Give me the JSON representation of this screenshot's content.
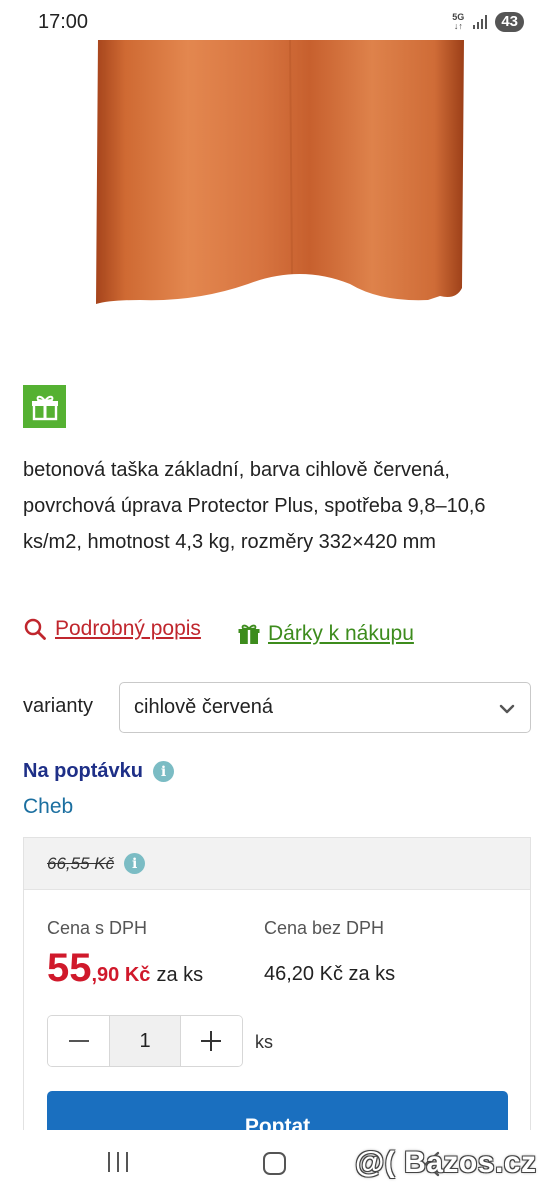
{
  "status_bar": {
    "time": "17:00",
    "network_top": "5G",
    "network_bottom": "↓↑",
    "battery": "43"
  },
  "product": {
    "image_icon": "roof-tile-image",
    "gift_badge_icon": "gift-icon",
    "description": "betonová taška základní, barva cihlově červená, povrchová úprava Protector Plus, spotřeba 9,8–10,6 ks/m2, hmotnost 4,3 kg, rozměry 332×420 mm"
  },
  "links": {
    "detail_label": "Podrobný popis",
    "gifts_label": "Dárky k nákupu"
  },
  "variant": {
    "label": "varianty",
    "selected": "cihlově červená"
  },
  "availability": {
    "status": "Na poptávku",
    "location": "Cheb"
  },
  "pricing": {
    "old_price": "66,55 Kč",
    "with_vat_label": "Cena s DPH",
    "without_vat_label": "Cena bez DPH",
    "price_int": "55",
    "price_dec": ",90 Kč",
    "price_unit": "za ks",
    "price_net": "46,20 Kč za ks"
  },
  "quantity": {
    "value": "1",
    "unit": "ks"
  },
  "cta": {
    "label": "Poptat"
  },
  "watermark": "@( Bazos.cz",
  "colors": {
    "accent_red": "#d0192b",
    "link_red": "#c0262d",
    "gift_green": "#55b132",
    "link_green": "#3d8c1d",
    "availability_blue": "#1e2f87",
    "location_blue": "#1b6fa0",
    "cta_blue": "#1a6fbf",
    "tile_orange": "#d9753b"
  }
}
